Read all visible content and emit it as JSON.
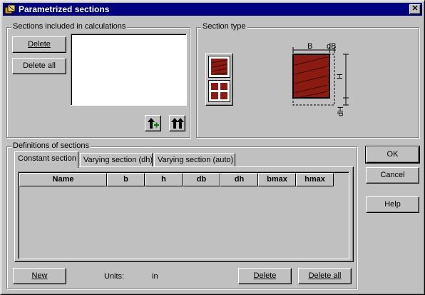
{
  "window": {
    "title": "Parametrized sections"
  },
  "sections_group": {
    "label": "Sections included in calculations",
    "delete_label": "Delete",
    "delete_all_label": "Delete all"
  },
  "section_type_group": {
    "label": "Section type",
    "dim_B": "B",
    "dim_dB": "dB",
    "dim_H": "H",
    "dim_dH": "dH"
  },
  "definitions_group": {
    "label": "Definitions of sections",
    "tabs": [
      {
        "label": "Constant section",
        "active": true
      },
      {
        "label": "Varying section (dh)",
        "active": false
      },
      {
        "label": "Varying section (auto)",
        "active": false
      }
    ],
    "columns": [
      "Name",
      "b",
      "h",
      "db",
      "dh",
      "bmax",
      "hmax"
    ],
    "new_label": "New",
    "units_label": "Units:",
    "units_value": "in",
    "delete_label": "Delete",
    "delete_all_label": "Delete all"
  },
  "dialog_buttons": {
    "ok": "OK",
    "cancel": "Cancel",
    "help": "Help"
  },
  "colors": {
    "title_bar": "#000080",
    "section_fill": "#8b1a10",
    "face": "#c0c0c0"
  },
  "icons": {
    "app": "sections-app-icon",
    "add_section": "arrow-up-plus-icon",
    "add_all_sections": "double-arrow-up-icon"
  }
}
